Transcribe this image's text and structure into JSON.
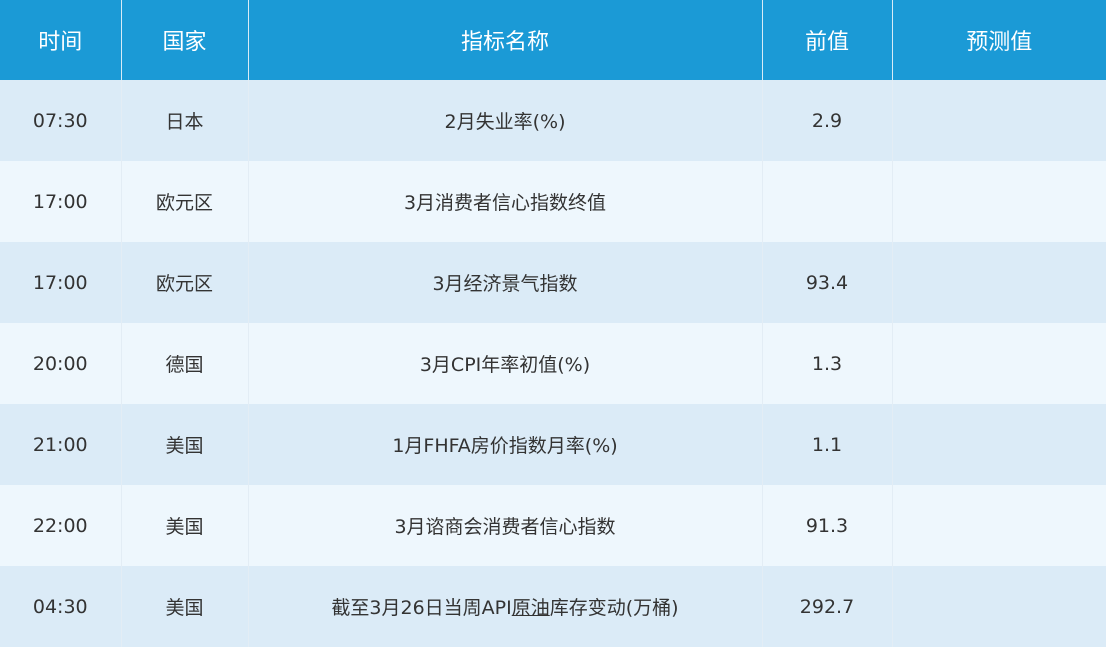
{
  "header": {
    "time": "时间",
    "country": "国家",
    "indicator": "指标名称",
    "previous": "前值",
    "forecast": "预测值"
  },
  "rows": [
    {
      "time": "07:30",
      "country": "日本",
      "indicator": "2月失业率(%)",
      "previous": "2.9",
      "forecast": ""
    },
    {
      "time": "17:00",
      "country": "欧元区",
      "indicator": "3月消费者信心指数终值",
      "previous": "",
      "forecast": ""
    },
    {
      "time": "17:00",
      "country": "欧元区",
      "indicator": "3月经济景气指数",
      "previous": "93.4",
      "forecast": ""
    },
    {
      "time": "20:00",
      "country": "德国",
      "indicator": "3月CPI年率初值(%)",
      "previous": "1.3",
      "forecast": ""
    },
    {
      "time": "21:00",
      "country": "美国",
      "indicator": "1月FHFA房价指数月率(%)",
      "previous": "1.1",
      "forecast": ""
    },
    {
      "time": "22:00",
      "country": "美国",
      "indicator": "3月谘商会消费者信心指数",
      "previous": "91.3",
      "forecast": ""
    },
    {
      "time": "04:30",
      "country": "美国",
      "indicator_prefix": "截至3月26日当周API",
      "indicator_link": "原油",
      "indicator_suffix": "库存变动(万桶)",
      "previous": "292.7",
      "forecast": ""
    }
  ],
  "colors": {
    "header_bg": "#1b9ad6",
    "row_odd_bg": "#dbebf7",
    "row_even_bg": "#eef7fd",
    "text": "#333333"
  }
}
